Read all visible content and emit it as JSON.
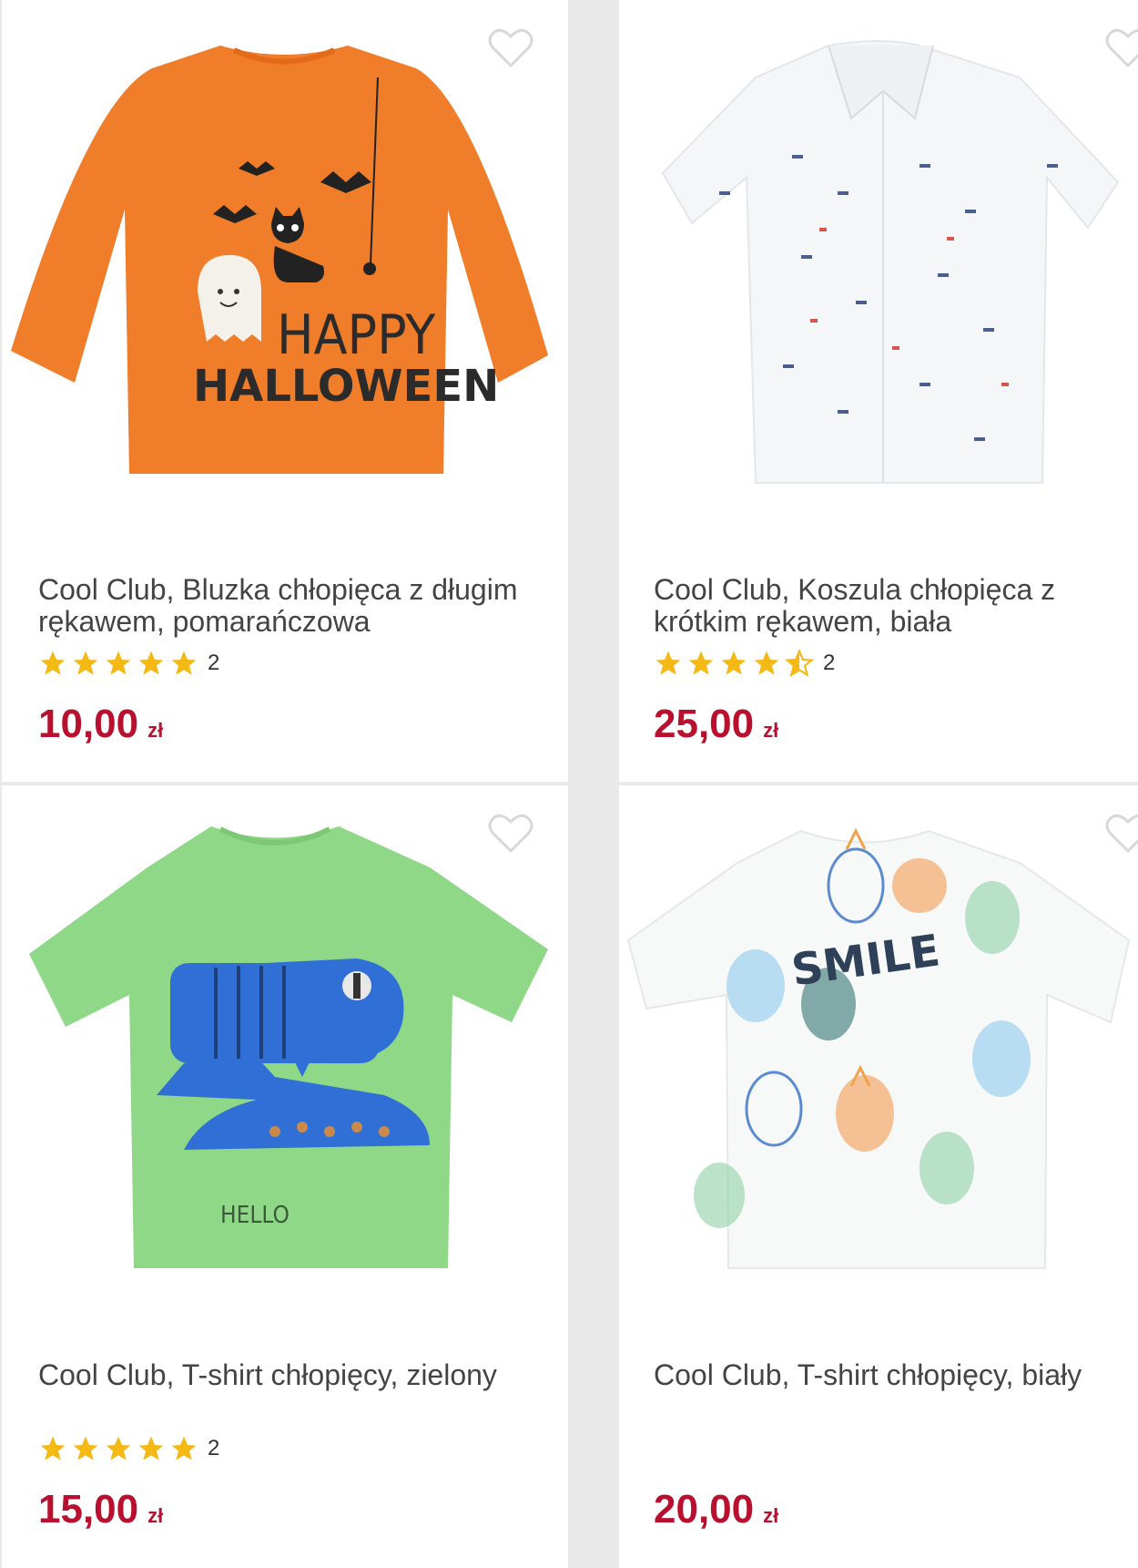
{
  "products": [
    {
      "title": "Cool Club, Bluzka chłopięca z długim rękawem, pomarańczowa",
      "rating_value": 5,
      "rating_count": "2",
      "price": "10,00",
      "currency": "zł",
      "image_text_1": "HAPPY",
      "image_text_2": "HALLOWEEN",
      "image_color": "#f07d2a"
    },
    {
      "title": "Cool Club, Koszula chłopięca z krótkim rękawem, biała",
      "rating_value": 4.5,
      "rating_count": "2",
      "price": "25,00",
      "currency": "zł",
      "image_color": "#f4f6f8"
    },
    {
      "title": "Cool Club, T-shirt chłopięcy, zielony",
      "rating_value": 5,
      "rating_count": "2",
      "price": "15,00",
      "currency": "zł",
      "image_text_1": "HELLO",
      "image_color": "#8fd888"
    },
    {
      "title": "Cool Club, T-shirt chłopięcy, biały",
      "rating_value": 0,
      "rating_count": "",
      "price": "20,00",
      "currency": "zł",
      "image_text_1": "SMILE",
      "image_color": "#f7f9f8"
    }
  ],
  "colors": {
    "price": "#b8102e",
    "star": "#f5b916",
    "heart_outline": "#d8d8d8"
  },
  "icons": [
    "heart-outline-icon",
    "star-icon",
    "star-half-icon"
  ]
}
